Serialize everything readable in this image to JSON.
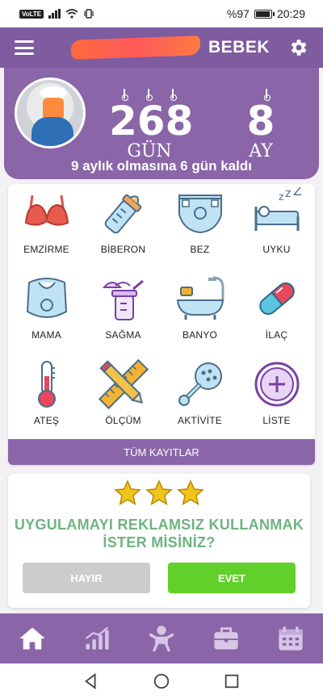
{
  "status_bar": {
    "network": "VoLTE",
    "battery": "%97",
    "time": "20:29"
  },
  "header": {
    "title": "BEBEK",
    "days_value": "268",
    "days_label": "GÜN",
    "months_value": "8",
    "months_label": "AY",
    "remaining_text": "9 aylık olmasına 6 gün kaldı"
  },
  "categories": [
    {
      "label": "EMZİRME",
      "icon": "bra-icon"
    },
    {
      "label": "BİBERON",
      "icon": "bottle-icon"
    },
    {
      "label": "BEZ",
      "icon": "diaper-icon"
    },
    {
      "label": "UYKU",
      "icon": "sleep-icon"
    },
    {
      "label": "MAMA",
      "icon": "bib-icon"
    },
    {
      "label": "SAĞMA",
      "icon": "breast-pump-icon"
    },
    {
      "label": "BANYO",
      "icon": "bathtub-icon"
    },
    {
      "label": "İLAÇ",
      "icon": "pill-icon"
    },
    {
      "label": "ATEŞ",
      "icon": "thermometer-icon"
    },
    {
      "label": "ÖLÇÜM",
      "icon": "ruler-pencil-icon"
    },
    {
      "label": "AKTİVİTE",
      "icon": "rattle-icon"
    },
    {
      "label": "LİSTE",
      "icon": "plus-circle-icon"
    }
  ],
  "all_records_label": "TÜM KAYITLAR",
  "promo": {
    "stars": 3,
    "text_line1": "UYGULAMAYI REKLAMSIZ KULLANMAK",
    "text_line2": "İSTER MİSİNİZ?",
    "no_label": "HAYIR",
    "yes_label": "EVET"
  },
  "bottom_nav": [
    "home-icon",
    "stats-icon",
    "baby-icon",
    "briefcase-icon",
    "calendar-icon"
  ],
  "colors": {
    "primary": "#8a66a8",
    "promo_text": "#6fb380",
    "yes_button": "#62d02a",
    "no_button": "#cccccc"
  }
}
